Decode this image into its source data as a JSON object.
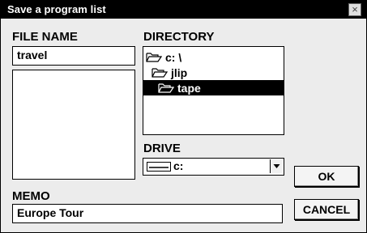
{
  "window": {
    "title": "Save a program list",
    "close_symbol": "×"
  },
  "file_name": {
    "label": "FILE NAME",
    "value": "travel",
    "list_items": []
  },
  "directory": {
    "label": "DIRECTORY",
    "items": [
      {
        "label": "c: \\",
        "selected": false
      },
      {
        "label": "jlip",
        "selected": false
      },
      {
        "label": "tape",
        "selected": true
      }
    ]
  },
  "drive": {
    "label": "DRIVE",
    "value": "c:"
  },
  "memo": {
    "label": "MEMO",
    "value": "Europe Tour"
  },
  "buttons": {
    "ok": "OK",
    "cancel": "CANCEL"
  }
}
